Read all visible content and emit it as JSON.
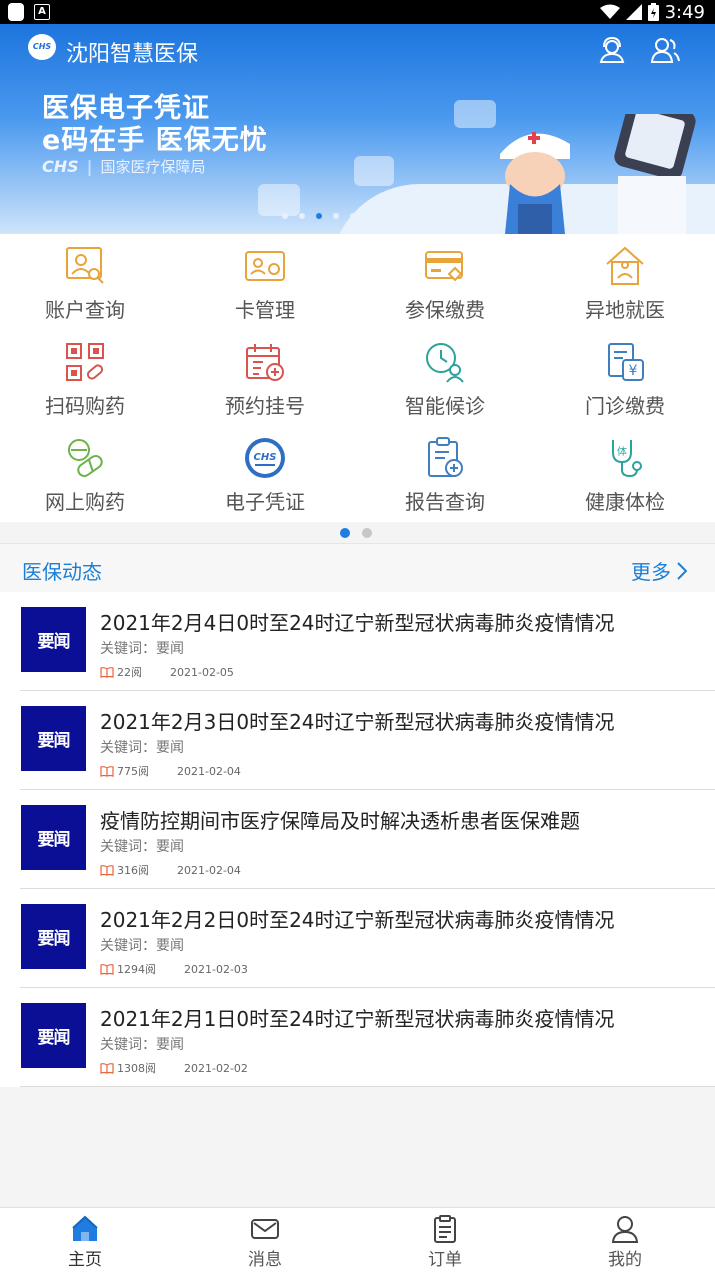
{
  "status_bar": {
    "time": "3:49",
    "app_badge": "A"
  },
  "header": {
    "app_logo": "CHS",
    "app_title": "沈阳智慧医保",
    "icons": [
      "customer-service-icon",
      "user-group-icon"
    ]
  },
  "banner": {
    "headline_1": "医保电子凭证",
    "headline_2": "e码在手 医保无忧",
    "brand": "CHS",
    "org": "国家医疗保障局",
    "slide_count": 8,
    "active_slide": 3
  },
  "grid": [
    {
      "label": "账户查询",
      "icon": "account-search-icon"
    },
    {
      "label": "卡管理",
      "icon": "card-manage-icon"
    },
    {
      "label": "参保缴费",
      "icon": "insurance-payment-icon"
    },
    {
      "label": "异地就医",
      "icon": "remote-medical-icon"
    },
    {
      "label": "扫码购药",
      "icon": "scan-buy-medicine-icon"
    },
    {
      "label": "预约挂号",
      "icon": "appointment-icon"
    },
    {
      "label": "智能候诊",
      "icon": "smart-waiting-icon"
    },
    {
      "label": "门诊缴费",
      "icon": "outpatient-payment-icon"
    },
    {
      "label": "网上购药",
      "icon": "online-medicine-icon"
    },
    {
      "label": "电子凭证",
      "icon": "e-voucher-icon"
    },
    {
      "label": "报告查询",
      "icon": "report-query-icon"
    },
    {
      "label": "健康体检",
      "icon": "health-checkup-icon"
    }
  ],
  "grid_pages": {
    "count": 2,
    "active": 1
  },
  "news": {
    "section_title": "医保动态",
    "more_label": "更多",
    "items": [
      {
        "thumb": "要闻",
        "title": "2021年2月4日0时至24时辽宁新型冠状病毒肺炎疫情情况",
        "keywords": "关键词：要闻",
        "reads": "22阅",
        "date": "2021-02-05"
      },
      {
        "thumb": "要闻",
        "title": "2021年2月3日0时至24时辽宁新型冠状病毒肺炎疫情情况",
        "keywords": "关键词：要闻",
        "reads": "775阅",
        "date": "2021-02-04"
      },
      {
        "thumb": "要闻",
        "title": "疫情防控期间市医疗保障局及时解决透析患者医保难题",
        "keywords": "关键词：要闻",
        "reads": "316阅",
        "date": "2021-02-04"
      },
      {
        "thumb": "要闻",
        "title": "2021年2月2日0时至24时辽宁新型冠状病毒肺炎疫情情况",
        "keywords": "关键词：要闻",
        "reads": "1294阅",
        "date": "2021-02-03"
      },
      {
        "thumb": "要闻",
        "title": "2021年2月1日0时至24时辽宁新型冠状病毒肺炎疫情情况",
        "keywords": "关键词：要闻",
        "reads": "1308阅",
        "date": "2021-02-02"
      }
    ]
  },
  "tabbar": [
    {
      "label": "主页",
      "icon": "home-icon",
      "active": true
    },
    {
      "label": "消息",
      "icon": "message-icon",
      "active": false
    },
    {
      "label": "订单",
      "icon": "order-icon",
      "active": false
    },
    {
      "label": "我的",
      "icon": "profile-icon",
      "active": false
    }
  ],
  "colors": {
    "primary": "#1b7fd6",
    "news_thumb": "#0a0f96",
    "grid_orange": "#e8a33a",
    "grid_red": "#d9534f",
    "grid_teal": "#2aa39a",
    "grid_blue": "#3f7fc0"
  }
}
